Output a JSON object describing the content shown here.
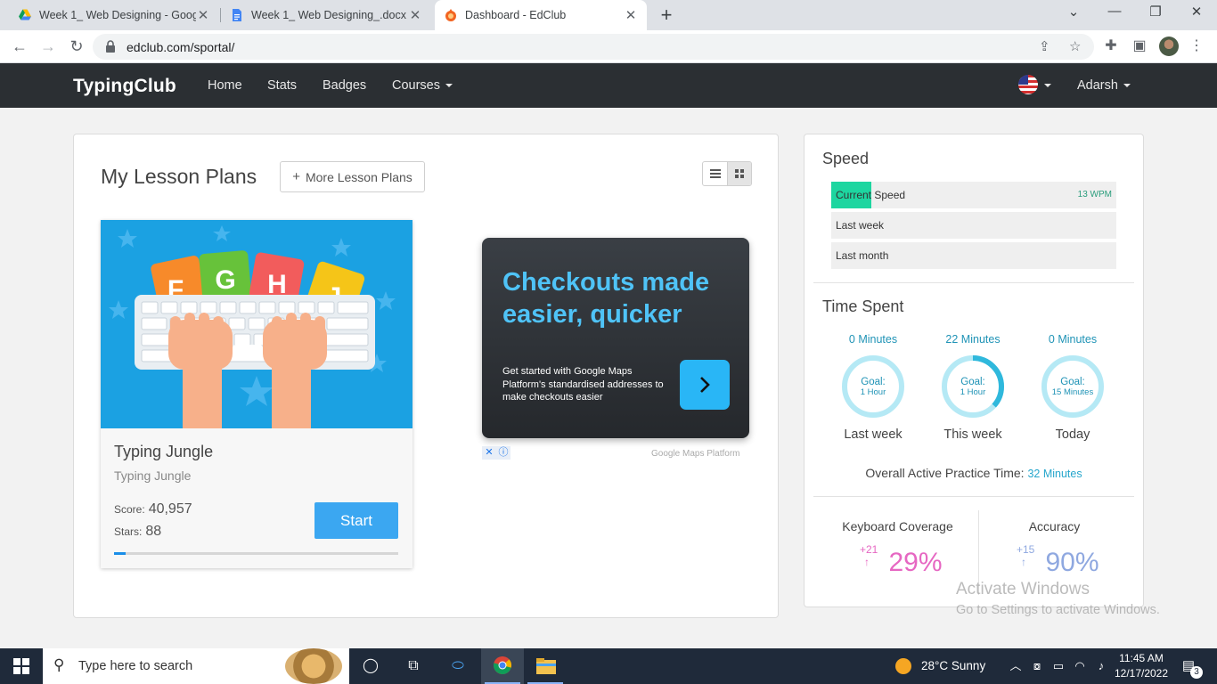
{
  "browser": {
    "tabs": [
      {
        "title": "Week 1_ Web Designing - Google",
        "icon": "google-drive-icon"
      },
      {
        "title": "Week 1_ Web Designing_.docx - G",
        "icon": "google-docs-icon"
      },
      {
        "title": "Dashboard - EdClub",
        "icon": "edclub-icon"
      }
    ],
    "url": "edclub.com/sportal/"
  },
  "nav": {
    "brand": "TypingClub",
    "links": [
      "Home",
      "Stats",
      "Badges",
      "Courses"
    ],
    "user": "Adarsh"
  },
  "lessons": {
    "title": "My Lesson Plans",
    "more_button": "More Lesson Plans",
    "card": {
      "name": "Typing Jungle",
      "subtitle": "Typing Jungle",
      "score_label": "Score:",
      "score": "40,957",
      "stars_label": "Stars:",
      "stars": "88",
      "start_label": "Start",
      "progress": 0.04,
      "key_letters": [
        "F",
        "G",
        "H",
        "J"
      ]
    }
  },
  "ad": {
    "headline": "Checkouts made easier, quicker",
    "body": "Get started with Google Maps Platform's standardised addresses to make checkouts easier",
    "brand": "Google Maps Platform"
  },
  "speed": {
    "title": "Speed",
    "bars": [
      {
        "label": "Current Speed",
        "value": "13 WPM",
        "fraction": 0.14
      },
      {
        "label": "Last week",
        "value": "",
        "fraction": 0
      },
      {
        "label": "Last month",
        "value": "",
        "fraction": 0
      }
    ]
  },
  "time_spent": {
    "title": "Time Spent",
    "items": [
      {
        "minutes": "0 Minutes",
        "goal_label": "Goal:",
        "goal": "1 Hour",
        "label": "Last week",
        "fraction": 0
      },
      {
        "minutes": "22 Minutes",
        "goal_label": "Goal:",
        "goal": "1 Hour",
        "label": "This week",
        "fraction": 0.3667
      },
      {
        "minutes": "0 Minutes",
        "goal_label": "Goal:",
        "goal": "15 Minutes",
        "label": "Today",
        "fraction": 0
      }
    ],
    "overall_label": "Overall Active Practice Time:",
    "overall_value": "32 Minutes"
  },
  "stats": {
    "coverage_label": "Keyboard Coverage",
    "coverage_value": "29%",
    "coverage_delta": "+21",
    "accuracy_label": "Accuracy",
    "accuracy_value": "90%",
    "accuracy_delta": "+15",
    "colors": {
      "coverage": "#e667c2",
      "accuracy": "#8fa8e0"
    }
  },
  "watermark": {
    "line1": "Activate Windows",
    "line2": "Go to Settings to activate Windows."
  },
  "taskbar": {
    "search_placeholder": "Type here to search",
    "weather": "28°C  Sunny",
    "time": "11:45 AM",
    "date": "12/17/2022",
    "notifications": "3"
  }
}
